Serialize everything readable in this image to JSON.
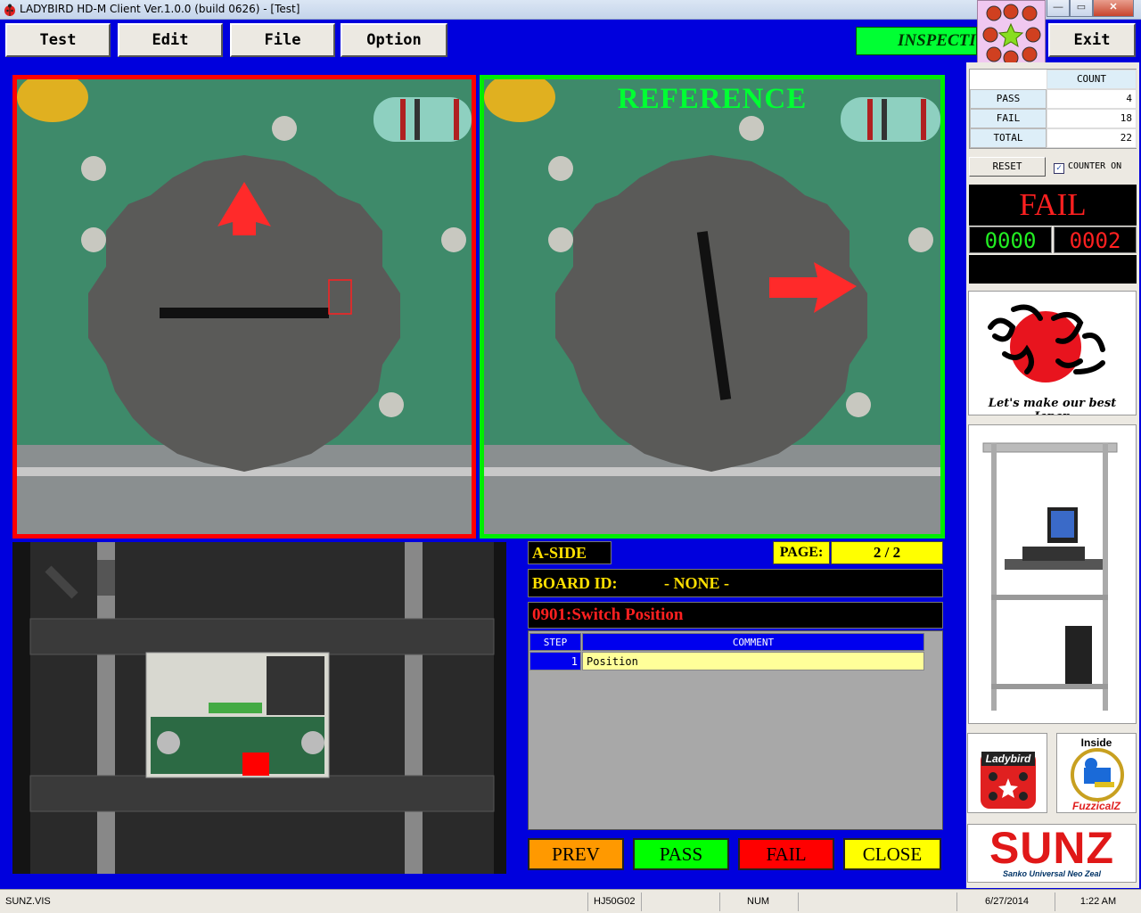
{
  "window": {
    "title": "LADYBIRD HD-M Client Ver.1.0.0  (build 0626) - [Test]",
    "controls": [
      "—",
      "▭",
      "✕"
    ]
  },
  "menu": {
    "test": "Test",
    "edit": "Edit",
    "file": "File",
    "option": "Option",
    "exit": "Exit"
  },
  "inspect_indicator": "INSPECTION",
  "panels": {
    "reference_label": "REFERENCE"
  },
  "info": {
    "side": "A-SIDE",
    "page_label": "PAGE:",
    "page_value": "2 / 2",
    "board_id_label": "BOARD ID:",
    "board_id_value": "- NONE -",
    "part": "0901:Switch Position"
  },
  "steps": {
    "headers": [
      "STEP",
      "COMMENT"
    ],
    "rows": [
      {
        "step": "1",
        "comment": "Position"
      }
    ]
  },
  "actions": {
    "prev": "PREV",
    "pass": "PASS",
    "fail": "FAIL",
    "close": "CLOSE"
  },
  "counter": {
    "header": "COUNT",
    "pass_label": "PASS",
    "pass_value": "4",
    "fail_label": "FAIL",
    "fail_value": "18",
    "total_label": "TOTAL",
    "total_value": "22",
    "reset": "RESET",
    "counter_on": "COUNTER ON",
    "counter_checked": true
  },
  "judgement": {
    "result": "FAIL",
    "pass_digits": "0000",
    "fail_digits": "0002"
  },
  "logos": {
    "ganbaro_caption": "Let's make our best Japan",
    "ladybird": "Ladybird",
    "inside": "Inside",
    "fuzzicalz": "FuzzicalZ",
    "sunz": "SUNZ",
    "sunz_tagline": "Sanko Universal Neo Zeal"
  },
  "status": {
    "file": "SUNZ.VIS",
    "model": "HJ50G02",
    "num": "NUM",
    "date": "6/27/2014",
    "time": "1:22 AM"
  },
  "colors": {
    "frame_fail": "#ff0000",
    "frame_reference": "#00ee00",
    "background": "#0000dd",
    "prev": "#ff9900",
    "pass": "#00ff00",
    "fail": "#ff0000",
    "close": "#ffff00"
  }
}
